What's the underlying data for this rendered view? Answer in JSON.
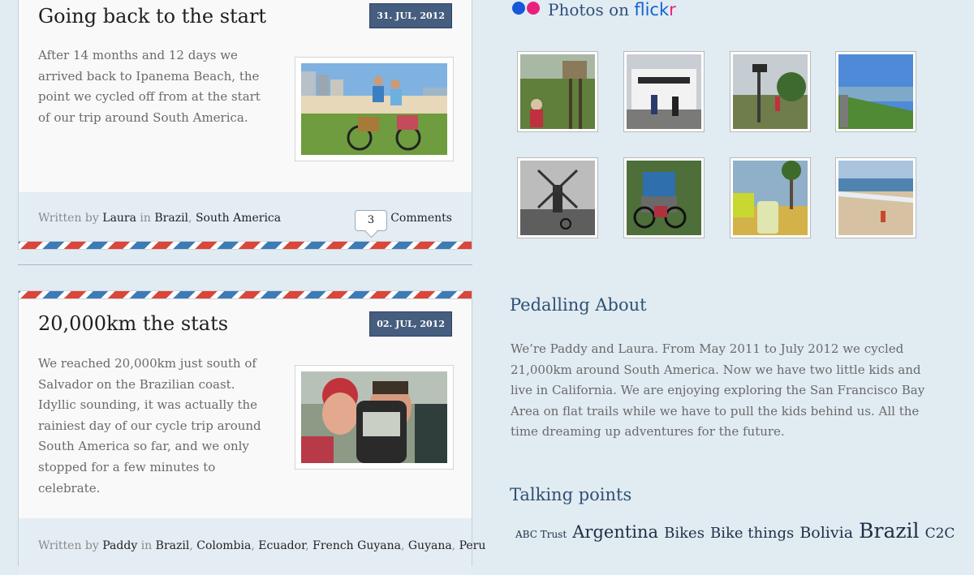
{
  "posts": [
    {
      "title": "Going back to the start",
      "date": "31. JUL, 2012",
      "excerpt": "After 14 months and 12 days we arrived back to Ipanema Beach, the point we cycled off from at the start of our trip around South America.",
      "meta": {
        "written_by": "Written by",
        "author": "Laura",
        "in": "in",
        "categories": [
          "Brazil",
          "South America"
        ],
        "comment_count": "3",
        "comments_label": "Comments"
      }
    },
    {
      "title": "20,000km the stats",
      "date": "02. JUL, 2012",
      "excerpt": "We reached 20,000km just south of Salvador on the Brazilian coast. Idyllic sounding, it was actually the rainiest day of our cycle trip around South America so far, and we only stopped for a few minutes to celebrate.",
      "meta": {
        "written_by": "Written by",
        "author": "Paddy",
        "in": "in",
        "categories": [
          "Brazil",
          "Colombia",
          "Ecuador",
          "French Guyana",
          "Guyana",
          "Peru"
        ]
      }
    }
  ],
  "flickr": {
    "heading": "Photos on",
    "logo_main": "flick",
    "logo_accent": "r"
  },
  "about": {
    "heading": "Pedalling About",
    "text": "We’re Paddy and Laura. From May 2011 to July 2012 we cycled 21,000km around South America. Now we have two little kids and live in California. We are enjoying exploring the San Francisco Bay Area on flat trails while we have to pull the kids behind us. All the time dreaming up adventures for the future."
  },
  "talking_points": {
    "heading": "Talking points",
    "tags": [
      "ABC Trust",
      "Argentina",
      "Bikes",
      "Bike things",
      "Bolivia",
      "Brazil",
      "C2C"
    ]
  },
  "colors": {
    "page_background": "#e1ebf2",
    "date_badge": "#455d7e",
    "airmail_red": "#d9463a",
    "airmail_blue": "#3d7bb5",
    "flickr_blue": "#0f63d5",
    "flickr_pink": "#e8207c"
  }
}
